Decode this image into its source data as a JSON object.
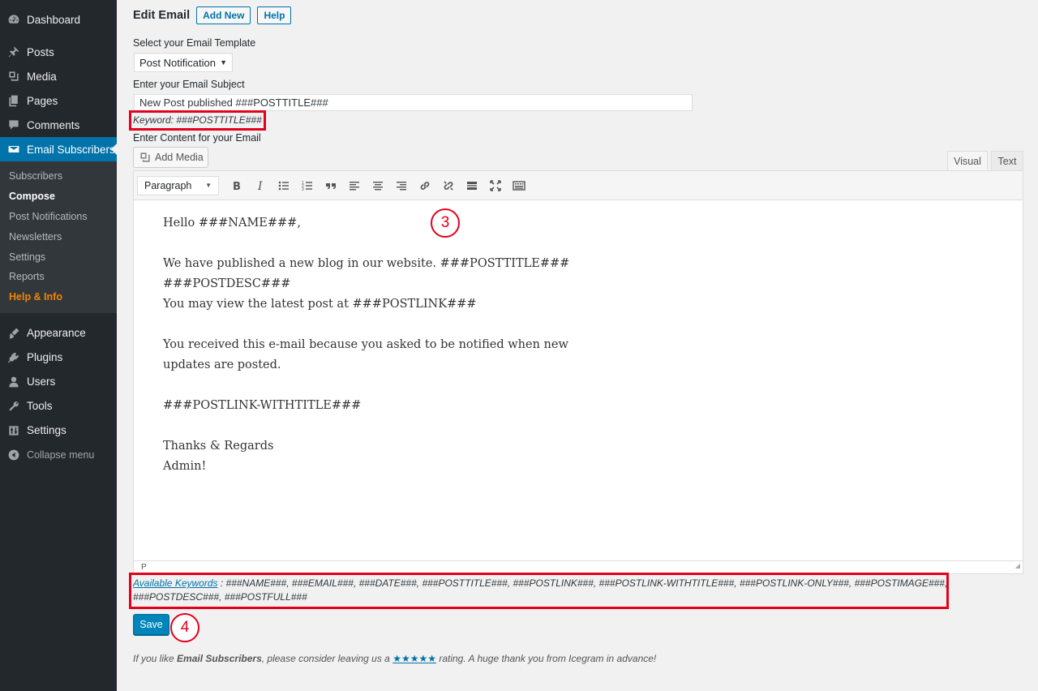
{
  "sidebar": {
    "items_top": [
      {
        "label": "Dashboard",
        "icon": "dashboard-icon"
      },
      {
        "label": "Posts",
        "icon": "pin-icon"
      },
      {
        "label": "Media",
        "icon": "media-icon"
      },
      {
        "label": "Pages",
        "icon": "pages-icon"
      },
      {
        "label": "Comments",
        "icon": "comment-icon"
      },
      {
        "label": "Email Subscribers",
        "icon": "email-icon"
      }
    ],
    "submenu": [
      "Subscribers",
      "Compose",
      "Post Notifications",
      "Newsletters",
      "Settings",
      "Reports",
      "Help & Info"
    ],
    "items_bottom": [
      {
        "label": "Appearance",
        "icon": "brush-icon"
      },
      {
        "label": "Plugins",
        "icon": "plugin-icon"
      },
      {
        "label": "Users",
        "icon": "user-icon"
      },
      {
        "label": "Tools",
        "icon": "wrench-icon"
      },
      {
        "label": "Settings",
        "icon": "settings-icon"
      }
    ],
    "collapse_label": "Collapse menu"
  },
  "header": {
    "title": "Edit Email",
    "add_new": "Add New",
    "help": "Help"
  },
  "form": {
    "template_label": "Select your Email Template",
    "template_value": "Post Notification",
    "subject_label": "Enter your Email Subject",
    "subject_value": "New Post published ###POSTTITLE###",
    "keyword_hint": "Keyword: ###POSTTITLE###",
    "content_label": "Enter Content for your Email",
    "add_media": "Add Media",
    "tab_visual": "Visual",
    "tab_text": "Text",
    "format_value": "Paragraph",
    "status_path": "P"
  },
  "content_lines": [
    "Hello ###NAME###,",
    "",
    "We have published a new blog in our website. ###POSTTITLE###",
    "###POSTDESC###",
    "You may view the latest post at ###POSTLINK###",
    "",
    "You received this e-mail because you asked to be notified when new",
    "updates are posted.",
    "",
    "###POSTLINK-WITHTITLE###",
    "",
    "Thanks & Regards",
    "Admin!"
  ],
  "keywords": {
    "link_label": "Available Keywords",
    "line1": " : ###NAME###, ###EMAIL###, ###DATE###, ###POSTTITLE###, ###POSTLINK###, ###POSTLINK-WITHTITLE###, ###POSTLINK-ONLY###, ###POSTIMAGE###,",
    "line2": "###POSTDESC###, ###POSTFULL###"
  },
  "save_label": "Save",
  "annotations": {
    "three": "3",
    "four": "4"
  },
  "footer": {
    "prefix": "If you like ",
    "plugin": "Email Subscribers",
    "middle": ", please consider leaving us a ",
    "stars": "★★★★★",
    "suffix": " rating. A huge thank you from Icegram in advance!"
  },
  "colors": {
    "accent": "#0073aa",
    "highlight": "#e3001b",
    "sidebar_bg": "#23282d",
    "help_orange": "#f18500"
  }
}
